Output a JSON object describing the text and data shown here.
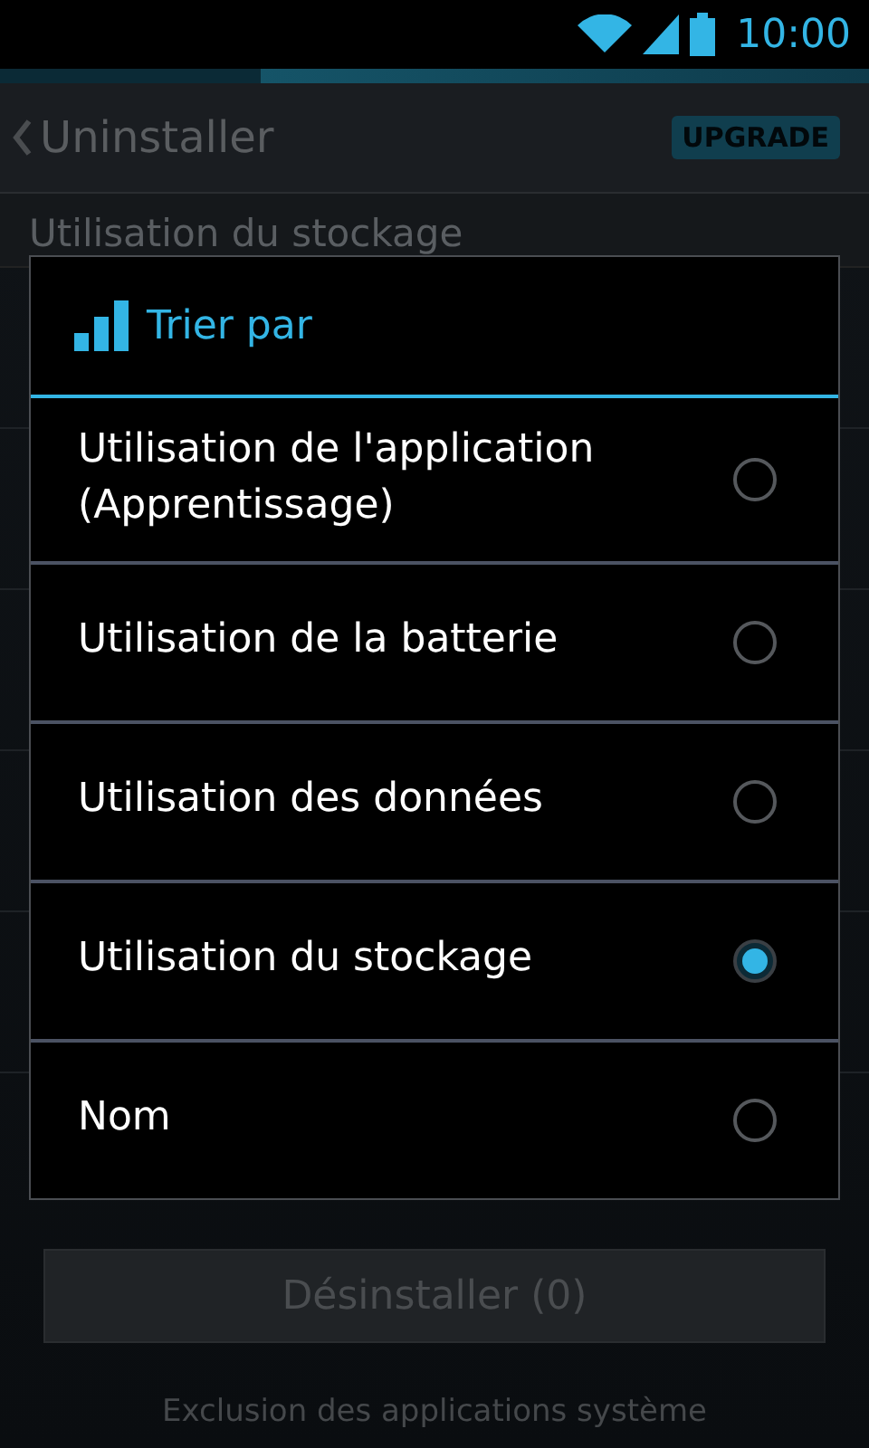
{
  "status_bar": {
    "time": "10:00"
  },
  "action_bar": {
    "title": "Uninstaller",
    "badge": "UPGRADE"
  },
  "section_header": "Utilisation du stockage",
  "dialog": {
    "title": "Trier par",
    "options": [
      {
        "label": "Utilisation de l'application (Apprentissage)",
        "selected": false
      },
      {
        "label": "Utilisation de la batterie",
        "selected": false
      },
      {
        "label": "Utilisation des données",
        "selected": false
      },
      {
        "label": "Utilisation du stockage",
        "selected": true
      },
      {
        "label": "Nom",
        "selected": false
      }
    ]
  },
  "uninstall_button": {
    "label": "Désinstaller (0)",
    "disabled": true
  },
  "footer": "Exclusion des applications système"
}
